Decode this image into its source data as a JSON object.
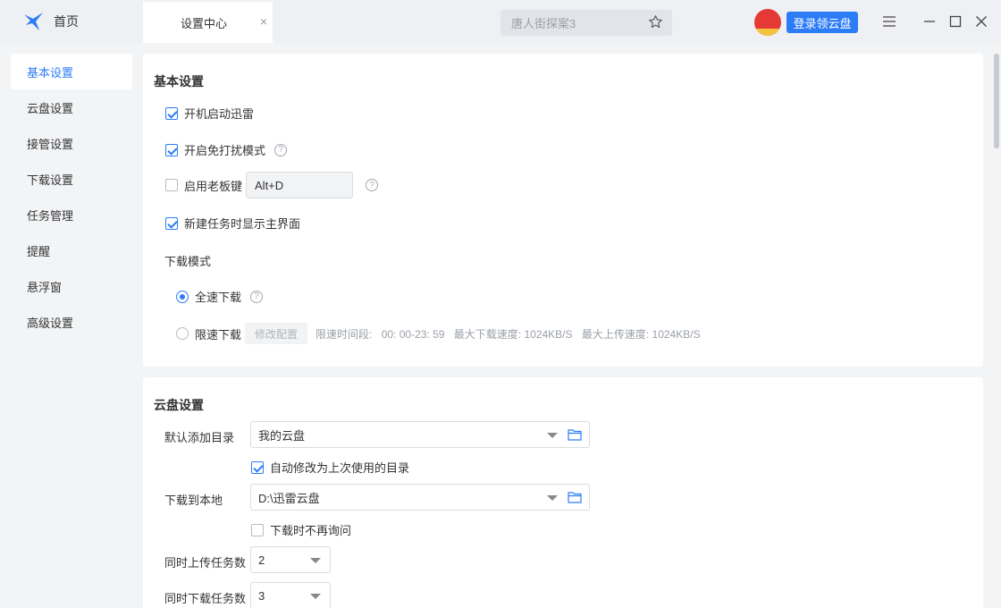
{
  "titlebar": {
    "home_label": "首页",
    "active_tab_label": "设置中心",
    "close_glyph": "×",
    "search_placeholder": "唐人街探案3",
    "login_label": "登录领云盘"
  },
  "sidebar": {
    "items": [
      {
        "label": "基本设置",
        "active": true
      },
      {
        "label": "云盘设置"
      },
      {
        "label": "接管设置"
      },
      {
        "label": "下载设置"
      },
      {
        "label": "任务管理"
      },
      {
        "label": "提醒"
      },
      {
        "label": "悬浮窗"
      },
      {
        "label": "高级设置"
      }
    ]
  },
  "basic": {
    "title": "基本设置",
    "autostart": "开机启动迅雷",
    "dnd_mode": "开启免打扰模式",
    "boss_key": "启用老板键",
    "boss_key_value": "Alt+D",
    "show_main": "新建任务时显示主界面",
    "download_mode_label": "下载模式",
    "full_speed": "全速下载",
    "limit_speed": "限速下载",
    "modify_config": "修改配置",
    "limit_period_label": "限速时间段:",
    "limit_period_value": "00: 00-23: 59",
    "max_down": "最大下载速度: 1024KB/S",
    "max_up": "最大上传速度: 1024KB/S"
  },
  "cloud": {
    "title": "云盘设置",
    "default_dir_label": "默认添加目录",
    "default_dir_value": "我的云盘",
    "auto_modify": "自动修改为上次使用的目录",
    "download_local_label": "下载到本地",
    "download_local_value": "D:\\迅雷云盘",
    "no_ask": "下载时不再询问",
    "upload_tasks_label": "同时上传任务数",
    "upload_tasks_value": "2",
    "download_tasks_label": "同时下载任务数",
    "download_tasks_value": "3"
  },
  "colors": {
    "accent": "#2b7cf6",
    "sidebar_bg": "#f3f4f6"
  }
}
